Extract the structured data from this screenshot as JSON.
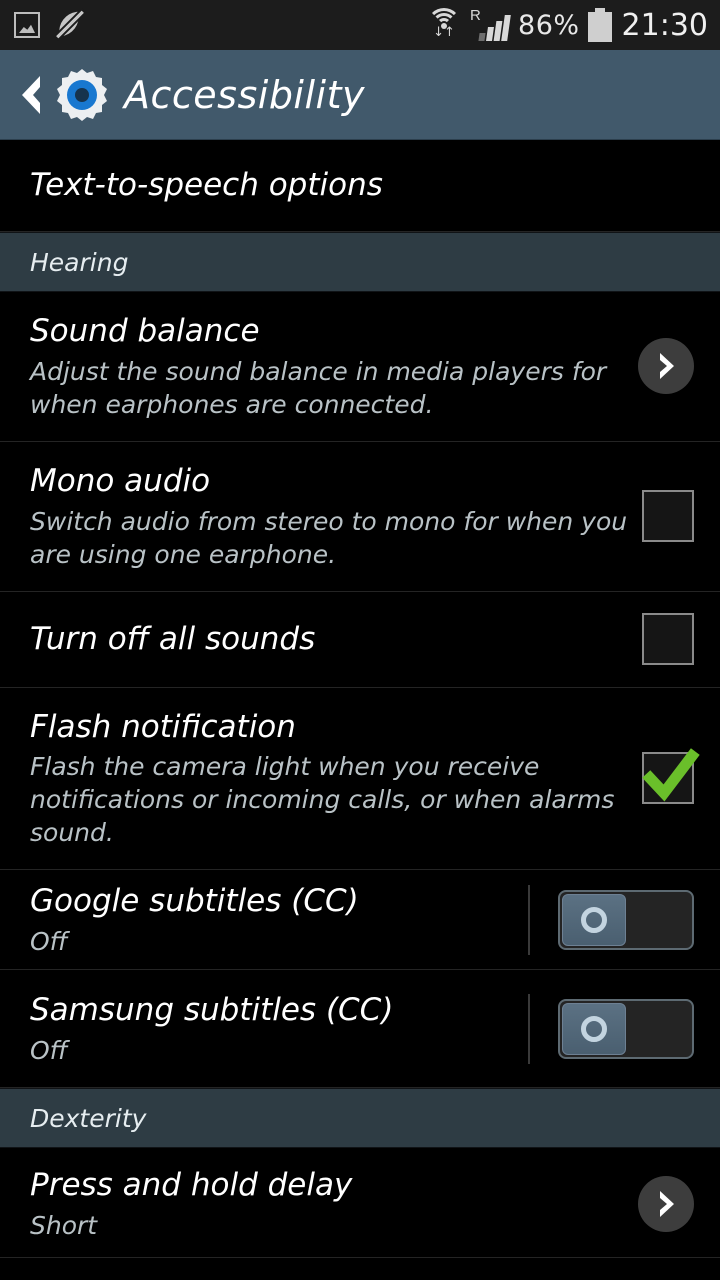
{
  "status_bar": {
    "icons": [
      "gallery-icon",
      "sound-muted-icon"
    ],
    "wifi_icon": "wifi-icon",
    "roaming_label": "R",
    "signal_icon": "signal-bars-icon",
    "battery_percent": "86%",
    "battery_icon": "battery-icon",
    "time": "21:30"
  },
  "title_bar": {
    "back_label": "back",
    "app_icon": "settings-gear-icon",
    "title": "Accessibility"
  },
  "rows": [
    {
      "id": "text-to-speech-options",
      "title": "Text-to-speech options",
      "subtitle": "",
      "accessory": "none"
    },
    {
      "id": "hearing-section",
      "title": "Hearing",
      "type": "section"
    },
    {
      "id": "sound-balance",
      "title": "Sound balance",
      "subtitle": "Adjust the sound balance in media players for when earphones are connected.",
      "accessory": "chevron"
    },
    {
      "id": "mono-audio",
      "title": "Mono audio",
      "subtitle": "Switch audio from stereo to mono for when you are using one earphone.",
      "accessory": "checkbox",
      "checked": false
    },
    {
      "id": "turn-off-all-sounds",
      "title": "Turn off all sounds",
      "subtitle": "",
      "accessory": "checkbox",
      "checked": false
    },
    {
      "id": "flash-notification",
      "title": "Flash notification",
      "subtitle": "Flash the camera light when you receive notifications or incoming calls, or when alarms sound.",
      "accessory": "checkbox",
      "checked": true
    },
    {
      "id": "google-subtitles",
      "title": "Google subtitles (CC)",
      "subtitle": "Off",
      "accessory": "toggle",
      "toggle_state": "off"
    },
    {
      "id": "samsung-subtitles",
      "title": "Samsung subtitles (CC)",
      "subtitle": "Off",
      "accessory": "toggle",
      "toggle_state": "off"
    },
    {
      "id": "dexterity-section",
      "title": "Dexterity",
      "type": "section"
    },
    {
      "id": "press-and-hold-delay",
      "title": "Press and hold delay",
      "subtitle": "Short",
      "accessory": "chevron"
    }
  ],
  "colors": {
    "title_bar_bg": "#41596b",
    "section_bg": "#2e3c44",
    "list_bg": "#000000",
    "check_green": "#6abf2a",
    "toggle_knob": "#5b7183",
    "gear_blue": "#1878d0"
  }
}
